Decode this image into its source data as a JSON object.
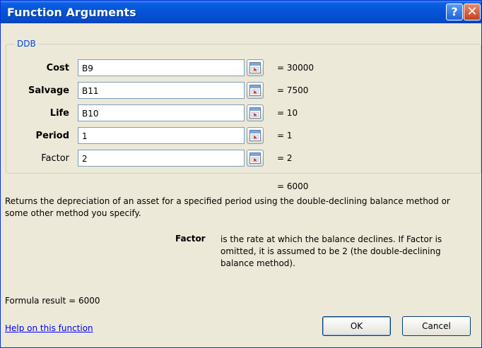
{
  "window": {
    "title": "Function Arguments",
    "help_glyph": "?",
    "close_glyph": "✕"
  },
  "function_name": "DDB",
  "arguments": [
    {
      "label": "Cost",
      "value": "B9",
      "result": "= 30000",
      "required": true
    },
    {
      "label": "Salvage",
      "value": "B11",
      "result": "= 7500",
      "required": true
    },
    {
      "label": "Life",
      "value": "B10",
      "result": "= 10",
      "required": true
    },
    {
      "label": "Period",
      "value": "1",
      "result": "= 1",
      "required": true
    },
    {
      "label": "Factor",
      "value": "2",
      "result": "= 2",
      "required": false
    }
  ],
  "function_result": "= 6000",
  "description": "Returns the depreciation of an asset for a specified period using the double-declining balance method or some other method you specify.",
  "argument_help": {
    "name": "Factor",
    "text": "is the rate at which the balance declines. If Factor is omitted, it is assumed to be 2 (the double-declining balance method)."
  },
  "formula_result": "Formula result =   6000",
  "help_link": "Help on this function",
  "buttons": {
    "ok": "OK",
    "cancel": "Cancel"
  },
  "colors": {
    "title_bar": "#0553d6",
    "dialog_bg": "#ece9d8",
    "link": "#0000ff",
    "group_label": "#0046d5"
  }
}
